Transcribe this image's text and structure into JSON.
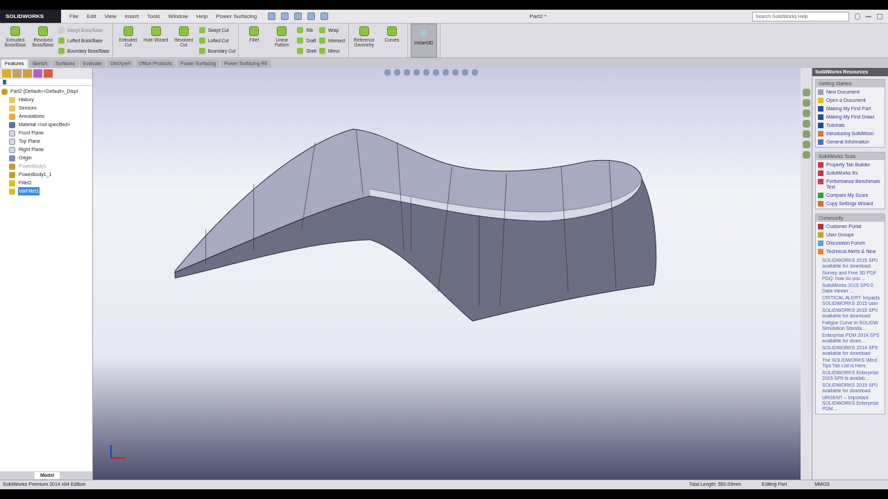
{
  "title_bar": {
    "logo": "SOLIDWORKS",
    "menu": [
      "File",
      "Edit",
      "View",
      "Insert",
      "Tools",
      "Window",
      "Help",
      "Power Surfacing"
    ],
    "document_title": "Part2 *",
    "search": {
      "placeholder": "Search SolidWorks Help"
    }
  },
  "ribbon": {
    "groups": [
      {
        "items": [
          {
            "kind": "large",
            "label": "Extruded Boss/Base",
            "disabled": false
          },
          {
            "kind": "large",
            "label": "Revolved Boss/Base",
            "disabled": false
          },
          {
            "kind": "stack",
            "items": [
              {
                "label": "Swept Boss/Base",
                "disabled": true
              },
              {
                "label": "Lofted Boss/Base",
                "disabled": false
              },
              {
                "label": "Boundary Boss/Base",
                "disabled": false
              }
            ]
          }
        ]
      },
      {
        "items": [
          {
            "kind": "large",
            "label": "Extruded Cut",
            "disabled": false
          },
          {
            "kind": "large",
            "label": "Hole Wizard",
            "disabled": false
          },
          {
            "kind": "large",
            "label": "Revolved Cut",
            "disabled": false
          },
          {
            "kind": "stack",
            "items": [
              {
                "label": "Swept Cut",
                "disabled": false
              },
              {
                "label": "Lofted Cut",
                "disabled": false
              },
              {
                "label": "Boundary Cut",
                "disabled": false
              }
            ]
          }
        ]
      },
      {
        "items": [
          {
            "kind": "large",
            "label": "Fillet",
            "disabled": false
          },
          {
            "kind": "large",
            "label": "Linear Pattern",
            "disabled": false
          },
          {
            "kind": "stack",
            "items": [
              {
                "label": "Rib",
                "disabled": false
              },
              {
                "label": "Draft",
                "disabled": false
              },
              {
                "label": "Shell",
                "disabled": false
              }
            ]
          },
          {
            "kind": "stack",
            "items": [
              {
                "label": "Wrap",
                "disabled": false
              },
              {
                "label": "Intersect",
                "disabled": false
              },
              {
                "label": "Mirror",
                "disabled": false
              }
            ]
          }
        ]
      },
      {
        "items": [
          {
            "kind": "large",
            "label": "Reference Geometry",
            "disabled": false
          },
          {
            "kind": "large",
            "label": "Curves",
            "disabled": false
          }
        ]
      },
      {
        "items": [
          {
            "kind": "toggle",
            "label": "Instant3D",
            "selected": true
          }
        ]
      }
    ],
    "tabs": [
      {
        "label": "Features",
        "selected": true
      },
      {
        "label": "Sketch",
        "selected": false
      },
      {
        "label": "Surfaces",
        "selected": false
      },
      {
        "label": "Evaluate",
        "selected": false
      },
      {
        "label": "DimXpert",
        "selected": false
      },
      {
        "label": "Office Products",
        "selected": false
      },
      {
        "label": "Power Surfacing",
        "selected": false
      },
      {
        "label": "Power Surfacing RE",
        "selected": false
      }
    ]
  },
  "feature_tree": {
    "root": "Part2  (Default<<Default>_Displ",
    "items": [
      {
        "label": "History",
        "kind": "folder",
        "disabled": false,
        "selected": false
      },
      {
        "label": "Sensors",
        "kind": "folder",
        "disabled": false,
        "selected": false
      },
      {
        "label": "Annotations",
        "kind": "annotation",
        "disabled": false,
        "selected": false
      },
      {
        "label": "Material <not specified>",
        "kind": "material",
        "disabled": false,
        "selected": false
      },
      {
        "label": "Front Plane",
        "kind": "plane",
        "disabled": false,
        "selected": false
      },
      {
        "label": "Top Plane",
        "kind": "plane",
        "disabled": false,
        "selected": false
      },
      {
        "label": "Right Plane",
        "kind": "plane",
        "disabled": false,
        "selected": false
      },
      {
        "label": "Origin",
        "kind": "origin",
        "disabled": false,
        "selected": false
      },
      {
        "label": "PowerBody1",
        "kind": "body",
        "disabled": true,
        "selected": false
      },
      {
        "label": "PowerBody1_1",
        "kind": "body",
        "disabled": false,
        "selected": false
      },
      {
        "label": "Fillet2",
        "kind": "feature",
        "disabled": false,
        "selected": false
      },
      {
        "label": "VarFillet1",
        "kind": "feature",
        "disabled": false,
        "selected": true
      }
    ]
  },
  "bottom_tabs": [
    {
      "label": "Model",
      "selected": true
    }
  ],
  "resources": {
    "title": "SolidWorks Resources",
    "sections": [
      {
        "title": "Getting Started",
        "items": [
          {
            "label": "New Document",
            "color": "#9aa0b8"
          },
          {
            "label": "Open a Document",
            "color": "#e0c020"
          },
          {
            "label": "Making My First Part",
            "color": "#2a4a9a"
          },
          {
            "label": "Making My First Drawi",
            "color": "#2a4a9a"
          },
          {
            "label": "Tutorials",
            "color": "#2a4a9a"
          },
          {
            "label": "Introducing SolidWorn",
            "color": "#d08030"
          },
          {
            "label": "General Information",
            "color": "#4a6ad0"
          }
        ]
      },
      {
        "title": "SolidWorks Tools",
        "items": [
          {
            "label": "Property Tab Builder",
            "color": "#d03050"
          },
          {
            "label": "SolidWorks Rx",
            "color": "#d03050"
          },
          {
            "label": "Performance Benchmark Test",
            "color": "#c04060"
          },
          {
            "label": "Compare My Score",
            "color": "#30a040"
          },
          {
            "label": "Copy Settings Wizard",
            "color": "#d07030"
          }
        ]
      },
      {
        "title": "Community",
        "items": [
          {
            "label": "Customer Portal",
            "color": "#c03030"
          },
          {
            "label": "User Groups",
            "color": "#d0a020"
          },
          {
            "label": "Discussion Forum",
            "color": "#60a0e0"
          },
          {
            "label": "Technical Alerts & New",
            "color": "#f08020"
          }
        ]
      }
    ],
    "news": [
      "SOLIDWORKS 2015 SP0 available for download",
      "Survey and Free 3D PDF PDQ: how do you ...",
      "SolidWorks 2015 SP0.0 Data Viewer ...",
      "CRITICAL ALERT: Impacts SOLIDWORKS 2015 user",
      "SOLIDWORKS 2015 SP0 available for download",
      "Fatigue Curve in SOLIDW Simulation Standa...",
      "Enterprise PDM 2014 SP5 available for down...",
      "SOLIDWORKS 2014 SP5 available for download",
      "The SOLIDWORKS Wind Tips Tab List is Here",
      "SOLIDWORKS Enterprise 2015 SP0 is availab...",
      "SOLIDWORKS 2015 SP0 available for download",
      "URGENT – Important SOLIDWORKS Enterprise PDM..."
    ]
  },
  "status_bar": {
    "edition": "SolidWorks Premium 2014 x64 Edition",
    "total_length": "Total Length: 550.09mm",
    "mode": "Editing Part",
    "units": "MMGS"
  }
}
